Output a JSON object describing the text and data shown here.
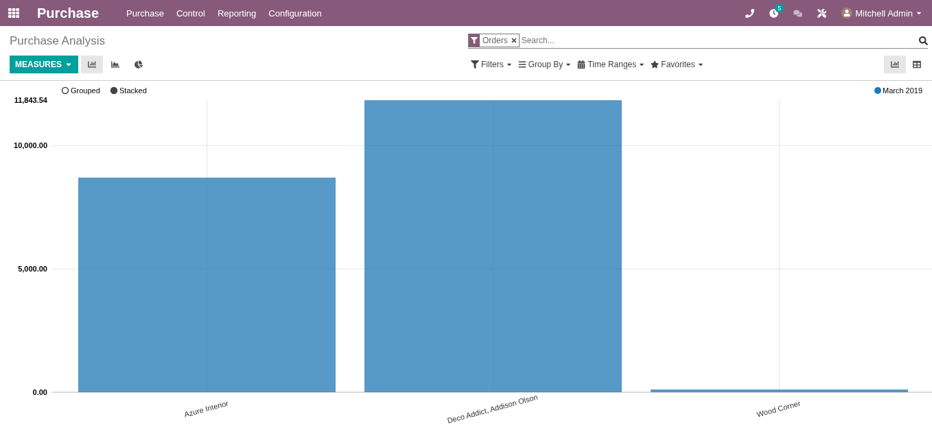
{
  "navbar": {
    "app_title": "Purchase",
    "menu": [
      "Purchase",
      "Control",
      "Reporting",
      "Configuration"
    ],
    "activity_count": "5",
    "user": "Mitchell Admin"
  },
  "breadcrumb": "Purchase Analysis",
  "search": {
    "facets": [
      {
        "label": "Orders"
      }
    ],
    "placeholder": "Search..."
  },
  "measures_button": "MEASURES",
  "graph_modes": [
    {
      "kind": "bar",
      "selected": true
    },
    {
      "kind": "line",
      "selected": false
    },
    {
      "kind": "pie",
      "selected": false
    }
  ],
  "search_options": [
    {
      "kind": "filter",
      "label": "Filters"
    },
    {
      "kind": "group",
      "label": "Group By"
    },
    {
      "kind": "calendar",
      "label": "Time Ranges"
    },
    {
      "kind": "star",
      "label": "Favorites"
    }
  ],
  "views": [
    {
      "kind": "graph",
      "selected": true
    },
    {
      "kind": "pivot",
      "selected": false
    }
  ],
  "chart_modes": [
    {
      "label": "Grouped",
      "selected": false
    },
    {
      "label": "Stacked",
      "selected": true
    }
  ],
  "chart_data": {
    "type": "bar",
    "categories": [
      "Azure Interior",
      "Deco Addict, Addison Olson",
      "Wood Corner"
    ],
    "series": [
      {
        "name": "March 2019",
        "color": "#1f77b4",
        "values": [
          8700,
          11840,
          110
        ]
      }
    ],
    "ylim": [
      0,
      11843.54
    ],
    "yticks": [
      {
        "value": 0,
        "label": "0.00"
      },
      {
        "value": 5000,
        "label": "5,000.00"
      },
      {
        "value": 10000,
        "label": "10,000.00"
      },
      {
        "value": 11843.54,
        "label": "11,843.54"
      }
    ]
  }
}
